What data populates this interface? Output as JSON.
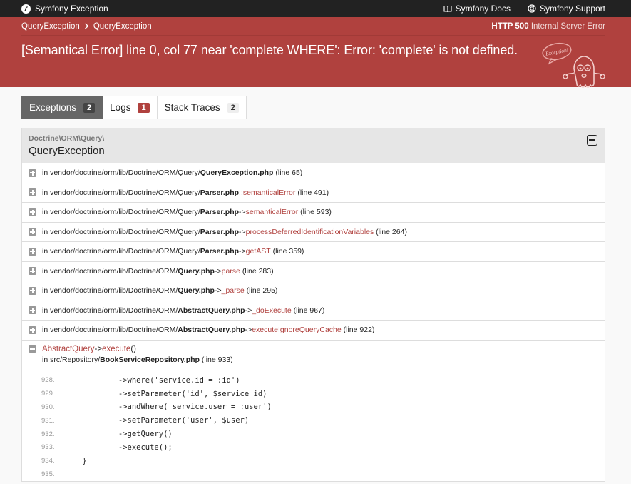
{
  "topbar": {
    "brand": "Symfony Exception",
    "docs": "Symfony Docs",
    "support": "Symfony Support"
  },
  "header": {
    "crumb1": "QueryException",
    "crumb2": "QueryException",
    "status_code": "HTTP 500",
    "status_text": "Internal Server Error",
    "message": "[Semantical Error] line 0, col 77 near 'complete WHERE': Error: 'complete' is not defined.",
    "ghost_label": "Exception!"
  },
  "tabs": [
    {
      "label": "Exceptions",
      "count": "2"
    },
    {
      "label": "Logs",
      "count": "1"
    },
    {
      "label": "Stack Traces",
      "count": "2"
    }
  ],
  "panel": {
    "namespace": "Doctrine\\ORM\\Query\\",
    "exception": "QueryException"
  },
  "trace": [
    {
      "pre": "in vendor/doctrine/orm/lib/Doctrine/ORM/Query/",
      "file": "QueryException.php",
      "sep": "",
      "fn": "",
      "line": "(line 65)"
    },
    {
      "pre": "in vendor/doctrine/orm/lib/Doctrine/ORM/Query/",
      "file": "Parser.php",
      "sep": "::",
      "fn": "semanticalError",
      "line": "(line 491)"
    },
    {
      "pre": "in vendor/doctrine/orm/lib/Doctrine/ORM/Query/",
      "file": "Parser.php",
      "sep": "->",
      "fn": "semanticalError",
      "line": "(line 593)"
    },
    {
      "pre": "in vendor/doctrine/orm/lib/Doctrine/ORM/Query/",
      "file": "Parser.php",
      "sep": "->",
      "fn": "processDeferredIdentificationVariables",
      "line": "(line 264)"
    },
    {
      "pre": "in vendor/doctrine/orm/lib/Doctrine/ORM/Query/",
      "file": "Parser.php",
      "sep": "->",
      "fn": "getAST",
      "line": "(line 359)"
    },
    {
      "pre": "in vendor/doctrine/orm/lib/Doctrine/ORM/",
      "file": "Query.php",
      "sep": "->",
      "fn": "parse",
      "line": "(line 283)"
    },
    {
      "pre": "in vendor/doctrine/orm/lib/Doctrine/ORM/",
      "file": "Query.php",
      "sep": "->",
      "fn": "_parse",
      "line": "(line 295)"
    },
    {
      "pre": "in vendor/doctrine/orm/lib/Doctrine/ORM/",
      "file": "AbstractQuery.php",
      "sep": "->",
      "fn": "_doExecute",
      "line": "(line 967)"
    },
    {
      "pre": "in vendor/doctrine/orm/lib/Doctrine/ORM/",
      "file": "AbstractQuery.php",
      "sep": "->",
      "fn": "executeIgnoreQueryCache",
      "line": "(line 922)"
    }
  ],
  "expanded": {
    "cls": "AbstractQuery",
    "sep": "->",
    "fn": "execute",
    "parens": "()",
    "file_pre": "in src/Repository/",
    "file": "BookServiceRepository.php",
    "line": "(line 933)"
  },
  "code": [
    {
      "n": "928.",
      "src": "            ->where('service.id = :id')"
    },
    {
      "n": "929.",
      "src": "            ->setParameter('id', $service_id)"
    },
    {
      "n": "930.",
      "src": "            ->andWhere('service.user = :user')"
    },
    {
      "n": "931.",
      "src": "            ->setParameter('user', $user)"
    },
    {
      "n": "932.",
      "src": "            ->getQuery()"
    },
    {
      "n": "933.",
      "src": "            ->execute();"
    },
    {
      "n": "934.",
      "src": "    }"
    },
    {
      "n": "935.",
      "src": ""
    }
  ]
}
